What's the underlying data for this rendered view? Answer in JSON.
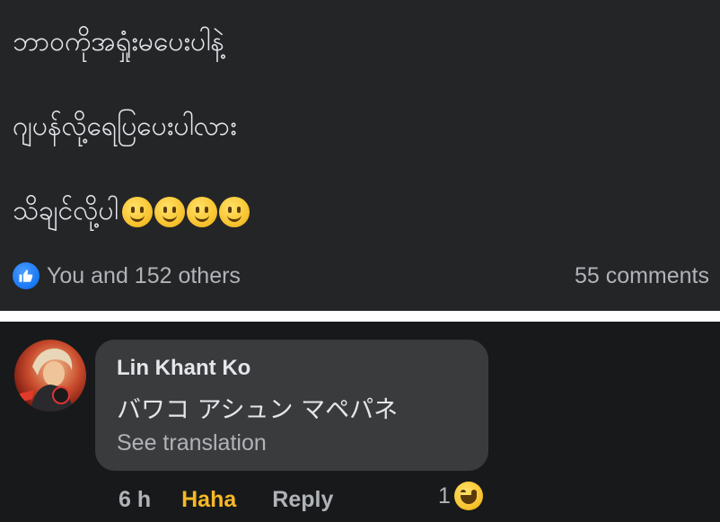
{
  "post": {
    "lines": [
      "ဘာဝကိုအရှုံးမပေးပါနဲ့",
      "ဂျပန်လို့ရေပြပေးပါလား",
      "သိချင်လို့ပါ"
    ],
    "emoji_icon": "slightly-smiling-face-icon",
    "emoji_count": 4,
    "like_summary": "You and 152 others",
    "comments_count": "55 comments",
    "like_icon": "thumbs-up-icon",
    "like_color": "#1877f2"
  },
  "comment": {
    "author": "Lin Khant Ko",
    "text": "バワコ アシュン マペパネ",
    "see_translation": "See translation",
    "time": "6 h",
    "haha_label": "Haha",
    "reply_label": "Reply",
    "reaction_count": "1",
    "reaction_icon": "laughing-face-icon",
    "haha_color": "#f7b928"
  },
  "colors": {
    "background": "#242527",
    "comment_background": "#18191a",
    "bubble": "#3a3b3c",
    "text_primary": "#e4e6eb",
    "text_secondary": "#b0b3b8"
  }
}
